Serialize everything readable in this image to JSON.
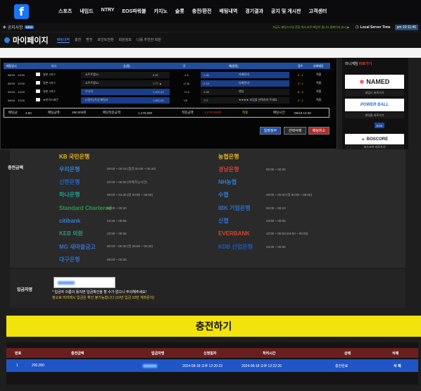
{
  "nav": {
    "logo": "f",
    "items": [
      "스포츠",
      "네임드",
      "NTRY",
      "EOS파워볼",
      "카지노",
      "슬롯",
      "충전/환전",
      "배팅내역",
      "경기결과",
      "공지 및 게시판",
      "고객센터"
    ]
  },
  "notice": {
    "label": "공지사항",
    "badge": "NEW",
    "scroll": "지금도 배팅스타일 혼합 에서 바로 배팅이 됩니다 홈페이지 [BY] ▶",
    "server_label": "Local Server Time",
    "server_time": "pm 10:11:46"
  },
  "mypage": {
    "title": "마이페이지",
    "tabs": [
      "배팅내역",
      "충전",
      "환전",
      "포인트전환",
      "회원정보",
      "나를 추천한 회원"
    ]
  },
  "betting": {
    "headers": [
      "배팅일시",
      "리그",
      "승(홈)",
      "무",
      "패(원정)",
      "점수",
      "상태배당"
    ],
    "rows": [
      {
        "date": "08/18",
        "time": "13:00",
        "league": "일본 J리그",
        "home": "쇼트트랩31",
        "home_odds": "3.32",
        "draw": "-1.5",
        "away": "1.38",
        "away_team": "자베른네",
        "score": "2 : 1",
        "status": "적중"
      },
      {
        "date": "08/18",
        "time": "13:00",
        "league": "일본 J리그",
        "home": "쇼트트랩31",
        "home_odds": "1.77 ▲",
        "draw": "(7.5)",
        "away": "2.19",
        "away_team": "자베른네",
        "score": "2 : 1",
        "status": "적중"
      },
      {
        "date": "08/18",
        "time": "13:00",
        "league": "일본 J리그",
        "home": "우니치",
        "home_odds": "1.421.42",
        "draw": "+1.5",
        "away": "2.28",
        "away_team": "맨섬",
        "score": "6 : 4",
        "status": "적중"
      },
      {
        "date": "08/18",
        "time": "13:00",
        "league": "★한국드래곤",
        "home": "[1경기] 이상 배팅사",
        "home_odds": "1.851.05",
        "draw": "VS",
        "away": "777",
        "away_team": "★★★★ 꼬임을 선택하여 주세요.",
        "score": "2 : 1",
        "status": "적중"
      }
    ],
    "summary": {
      "bet_time_label": "배팅금:",
      "bet_odds": "4.50",
      "bet_amount_label": "배팅금액:",
      "bet_amount": "260,000원",
      "expected_label": "배당적중금액:",
      "expected": "1,170,000",
      "win_label": "적중금액:",
      "win": "1,170,000원",
      "result": "적중",
      "date_label": "배팅시간:",
      "date": "08/18 12:30"
    },
    "buttons": [
      "일괄정부",
      "선택삭제",
      "배팅취소"
    ]
  },
  "sidebar": {
    "title_a": "미니게임 ",
    "title_b": "바로가기",
    "cards": [
      {
        "name": "NAMED",
        "caption": "네임드 바로가기"
      },
      {
        "name": "POWER BALL",
        "caption": "파워볼 바로가기"
      },
      {
        "name": "EOS",
        "caption": ""
      },
      {
        "name": "BOSCORE",
        "caption": "보스코어 바로가기"
      }
    ]
  },
  "banks": {
    "label": "충전금액",
    "left": [
      {
        "name": "KB 국민은행",
        "hours": "",
        "color": "#e8b21a"
      },
      {
        "name": "우리은행",
        "hours": "00:00 ~ 00:10 (점검 00:00 ~ 00:40)",
        "color": "#2a7fd6"
      },
      {
        "name": "신한은행",
        "hours": "23:00 ~ 06:00 (이체가능시간)",
        "color": "#1f64c9"
      },
      {
        "name": "하나은행",
        "hours": "00:00 ~ 01:30 (일 00:00 ~ 08:00)",
        "color": "#1aa39a"
      },
      {
        "name": "Standard Chartered",
        "hours": "00:00 ~ 00:30",
        "color": "#2a9a4a"
      },
      {
        "name": "citibank",
        "hours": "23:40 ~ 00:05",
        "color": "#3c7bd8"
      },
      {
        "name": "KEB 외환",
        "hours": "23:55 ~ 00:25",
        "color": "#2c8f7a"
      },
      {
        "name": "MG 새마을금고",
        "hours": "00:00 ~ 00:30 (일 00:00 ~ 00:30)",
        "color": "#3b6cc9"
      },
      {
        "name": "대구은행",
        "hours": "00:00 ~ 00:30",
        "color": "#2d6cc7"
      }
    ],
    "right": [
      {
        "name": "농협은행",
        "hours": "",
        "color": "#e8b21a"
      },
      {
        "name": "경남은행",
        "hours": "00:00 ~ 00:20",
        "color": "#d23a3a"
      },
      {
        "name": "NH농협",
        "hours": "",
        "color": "#2a7fd6"
      },
      {
        "name": "수협",
        "hours": "00:00 ~ 00:30 (일 00:00 ~ 08:00)",
        "color": "#2a7fd6"
      },
      {
        "name": "IBK 기업은행",
        "hours": "00:00 ~ 00:10",
        "color": "#2c6fc7"
      },
      {
        "name": "신협",
        "hours": "23:50 ~ 00:05",
        "color": "#2a74d8"
      },
      {
        "name": "EVERBANK",
        "hours": "23:50 ~ 00:00 (04:00 ~ 05:00)",
        "color": "#d2442a"
      },
      {
        "name": "KDB 산업은행",
        "hours": "23:30 ~ 00:30",
        "color": "#1f58b8"
      }
    ]
  },
  "depositor": {
    "label": "입금자명",
    "note1": "* 입금자 이름이 틀리면 입금확인을 할 수가 없으니 주의해주세요!",
    "note2": "정오로 미리메시 입금은 확인 불가능합니다 (10만 입금 10만 계좌문의)"
  },
  "charge": {
    "label": "충전하기"
  },
  "history": {
    "headers": [
      "번호",
      "충전금액",
      "입금자명",
      "신청일자",
      "처리시간",
      "상태",
      "삭제"
    ],
    "row": {
      "no": "1",
      "amount": "200,000",
      "date": "2024-08-18 오후 12:20:23",
      "processed": "2024-08-18 오후 12:22:26",
      "status": "충전완료",
      "delete": "삭 제"
    }
  }
}
